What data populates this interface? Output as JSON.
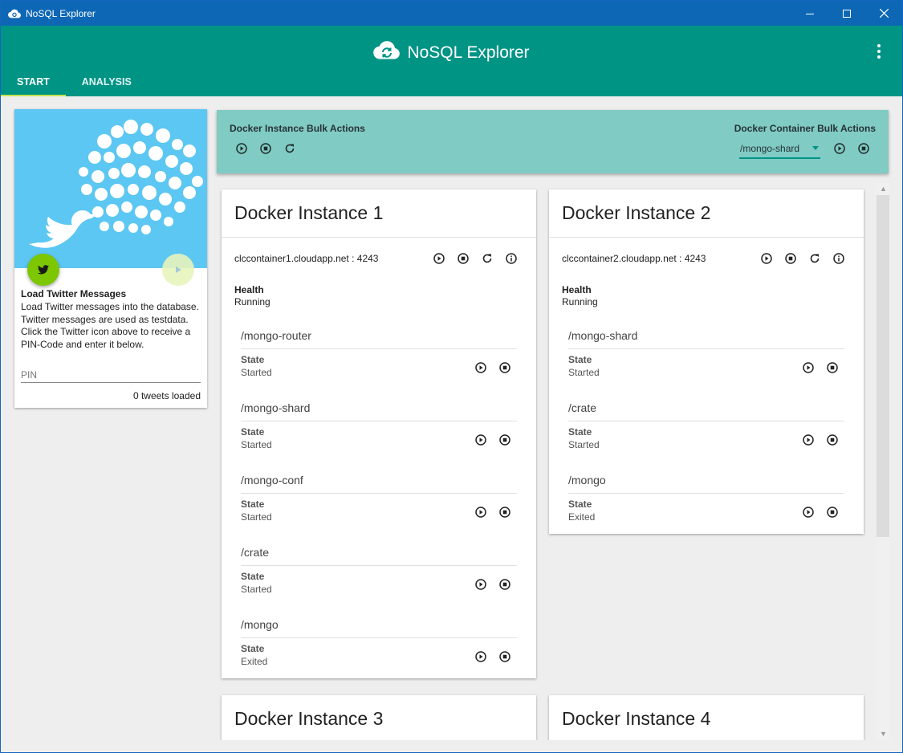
{
  "window": {
    "title": "NoSQL Explorer",
    "controls": [
      "minimize",
      "maximize",
      "close"
    ]
  },
  "appbar": {
    "title": "NoSQL Explorer",
    "brand_icon": "cloud-sync-icon",
    "menu_icon": "more-vert-icon",
    "accent_color": "#009485",
    "tabs": [
      {
        "label": "START",
        "active": true
      },
      {
        "label": "ANALYSIS",
        "active": false
      }
    ]
  },
  "twitter_card": {
    "title": "Load Twitter Messages",
    "description": "Load Twitter messages into the database. Twitter messages are used as testdata. Click the Twitter icon above to receive a PIN-Code and enter it below.",
    "pin_placeholder": "PIN",
    "pin_value": "",
    "tweets_loaded": "0 tweets loaded"
  },
  "bulk_actions": {
    "instance_label": "Docker Instance Bulk Actions",
    "container_label": "Docker Container Bulk Actions",
    "container_selected": "/mongo-shard"
  },
  "instances": [
    {
      "title": "Docker Instance 1",
      "host": "clccontainer1.cloudapp.net : 4243",
      "health_label": "Health",
      "health": "Running",
      "containers": [
        {
          "name": "/mongo-router",
          "state_label": "State",
          "state": "Started"
        },
        {
          "name": "/mongo-shard",
          "state_label": "State",
          "state": "Started"
        },
        {
          "name": "/mongo-conf",
          "state_label": "State",
          "state": "Started"
        },
        {
          "name": "/crate",
          "state_label": "State",
          "state": "Started"
        },
        {
          "name": "/mongo",
          "state_label": "State",
          "state": "Exited"
        }
      ]
    },
    {
      "title": "Docker Instance 2",
      "host": "clccontainer2.cloudapp.net : 4243",
      "health_label": "Health",
      "health": "Running",
      "containers": [
        {
          "name": "/mongo-shard",
          "state_label": "State",
          "state": "Started"
        },
        {
          "name": "/crate",
          "state_label": "State",
          "state": "Started"
        },
        {
          "name": "/mongo",
          "state_label": "State",
          "state": "Exited"
        }
      ]
    },
    {
      "title": "Docker Instance 3"
    },
    {
      "title": "Docker Instance 4"
    }
  ]
}
